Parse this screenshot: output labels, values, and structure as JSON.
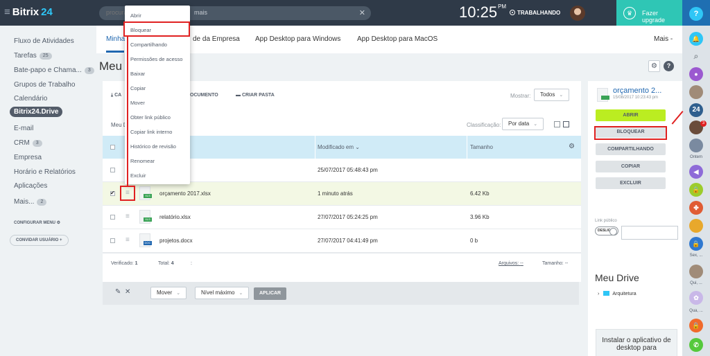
{
  "header": {
    "logo_text": "Bitrix",
    "logo_num": "24",
    "search_placeholder": "procurar",
    "search_suffix": "mais",
    "time": "10:25",
    "time_suffix": "PM",
    "work_status": "TRABALHANDO",
    "upgrade_label": "Fazer upgrade"
  },
  "left_menu": {
    "items": [
      {
        "label": "Fluxo de Atividades"
      },
      {
        "label": "Tarefas",
        "count": "25"
      },
      {
        "label": "Bate-papo e Chama...",
        "count": "3"
      },
      {
        "label": "Grupos de Trabalho"
      },
      {
        "label": "Calendário"
      },
      {
        "label": "Bitrix24.Drive"
      },
      {
        "label": "E-mail"
      },
      {
        "label": "CRM",
        "count": "3"
      },
      {
        "label": "Empresa"
      },
      {
        "label": "Horário e Relatórios"
      },
      {
        "label": "Aplicações"
      },
      {
        "label": "Mais...",
        "count": "2"
      }
    ],
    "configure": "CONFIGURAR MENU",
    "invite": "CONVIDAR USUÁRIO"
  },
  "tabs": [
    "Minha",
    "de da Empresa",
    "App Desktop para Windows",
    "App Desktop para MacOS",
    "Mais -"
  ],
  "page_title": "Meu D",
  "toolbar": {
    "upload": "CA",
    "document": "OCUMENTO",
    "create_folder": "CRIAR PASTA",
    "show_label": "Mostrar:",
    "show_value": "Todos",
    "sort_label": "Classificação:",
    "sort_value": "Por data",
    "breadcrumb": "Meu D"
  },
  "table": {
    "headers": [
      "Modificado em",
      "Tamanho"
    ],
    "rows": [
      {
        "name": "",
        "modified": "25/07/2017 05:48:43 pm",
        "size": ""
      },
      {
        "name": "orçamento 2017.xlsx",
        "modified": "1 minuto atrás",
        "size": "6.42 Kb",
        "type": "XLS"
      },
      {
        "name": "relatório.xlsx",
        "modified": "27/07/2017 05:24:25 pm",
        "size": "3.96 Kb",
        "type": "XLS"
      },
      {
        "name": "projetos.docx",
        "modified": "27/07/2017 04:41:49 pm",
        "size": "0 b",
        "type": "DOC"
      }
    ],
    "footer": {
      "verified_label": "Verificado:",
      "verified_value": "1",
      "total_label": "Total:",
      "total_value": "4",
      "sep": ":",
      "files_label": "Arquivos:",
      "files_value": "--",
      "size_label": "Tamanho:",
      "size_value": "--"
    }
  },
  "bottombar": {
    "move": "Mover",
    "level": "Nível máximo",
    "apply": "APLICAR"
  },
  "context_menu": [
    "Abrir",
    "Bloquear",
    "Compartilhando",
    "Permissões de acesso",
    "Baixar",
    "Copiar",
    "Mover",
    "Obter link público",
    "Copiar link interno",
    "Histórico de revisão",
    "Renomear",
    "Excluir"
  ],
  "right_panel": {
    "title": "orçamento 2...",
    "date": "15/08/2017 10:23:43 pm",
    "buttons": [
      "ABRIR",
      "BLOQUEAR",
      "COMPARTILHANDO",
      "COPIAR",
      "EXCLUIR"
    ],
    "public_link": "Link público",
    "toggle": "DESLIG",
    "drive_title": "Meu Drive",
    "folder": "Arquitetura",
    "promo": "Instalar o aplicativo de desktop para"
  },
  "rail": {
    "help": "?",
    "badge_24": "24",
    "badge_count": "3",
    "labels": [
      "Ontem",
      "Sex, ...",
      "Qui, ...",
      "Qua, ..."
    ]
  },
  "colors": {
    "header_bg": "#2f3a48",
    "accent_blue": "#2067b0",
    "upgrade_bg": "#2fc6b5",
    "open_button": "#bbed21",
    "highlight_red": "#e02020"
  }
}
